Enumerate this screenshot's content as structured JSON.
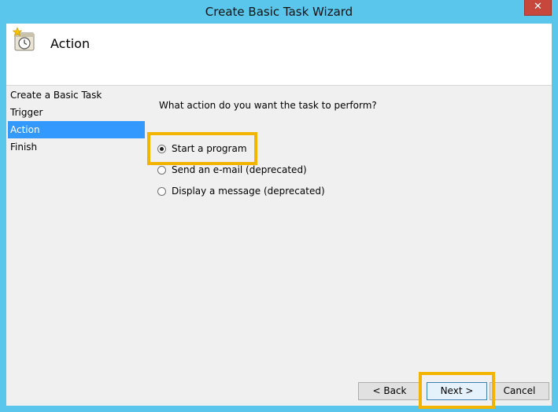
{
  "window": {
    "title": "Create Basic Task Wizard",
    "close_glyph": "✕",
    "accent": "#5ac6ec",
    "highlight_color": "#f3b400"
  },
  "header": {
    "icon": "task-clock-icon",
    "title": "Action"
  },
  "steps": [
    {
      "label": "Create a Basic Task",
      "active": false
    },
    {
      "label": "Trigger",
      "active": false
    },
    {
      "label": "Action",
      "active": true
    },
    {
      "label": "Finish",
      "active": false
    }
  ],
  "main": {
    "prompt": "What action do you want the task to perform?",
    "options": [
      {
        "label": "Start a program",
        "selected": true
      },
      {
        "label": "Send an e-mail (deprecated)",
        "selected": false
      },
      {
        "label": "Display a message (deprecated)",
        "selected": false
      }
    ]
  },
  "buttons": {
    "back": "< Back",
    "next": "Next >",
    "cancel": "Cancel"
  }
}
